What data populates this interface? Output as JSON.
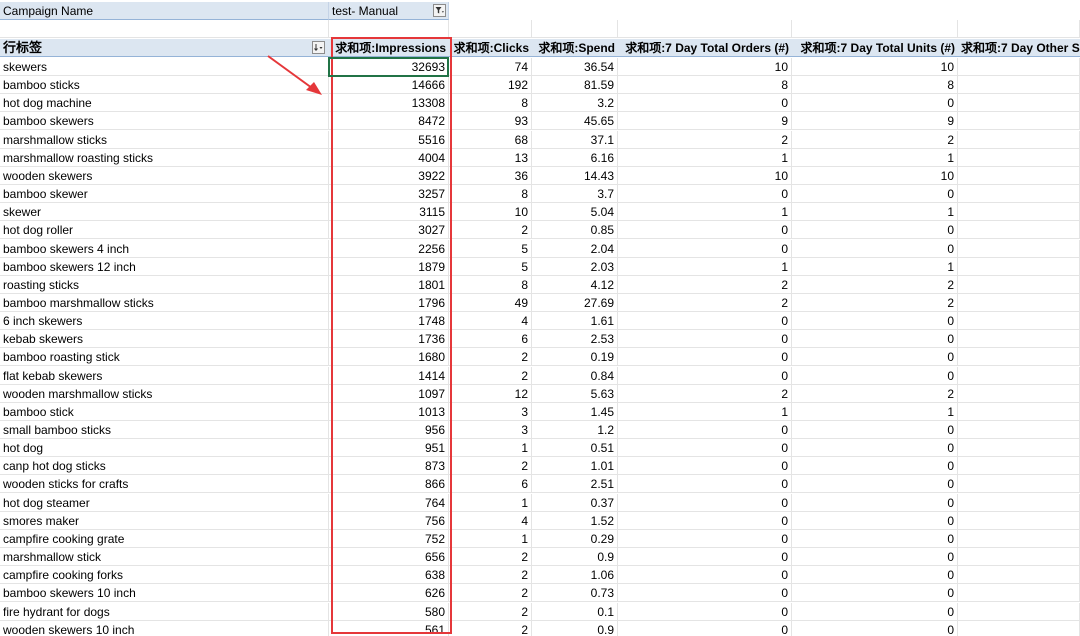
{
  "filter": {
    "label": "Campaign Name",
    "value": "test- Manual"
  },
  "columns": [
    "行标签",
    "求和项:Impressions",
    "求和项:Clicks",
    "求和项:Spend",
    "求和项:7 Day Total Orders (#)",
    "求和项:7 Day Total Units (#)",
    "求和项:7 Day Other S"
  ],
  "rows": [
    [
      "skewers",
      "32693",
      "74",
      "36.54",
      "10",
      "10"
    ],
    [
      "bamboo sticks",
      "14666",
      "192",
      "81.59",
      "8",
      "8"
    ],
    [
      "hot dog machine",
      "13308",
      "8",
      "3.2",
      "0",
      "0"
    ],
    [
      "bamboo skewers",
      "8472",
      "93",
      "45.65",
      "9",
      "9"
    ],
    [
      "marshmallow sticks",
      "5516",
      "68",
      "37.1",
      "2",
      "2"
    ],
    [
      "marshmallow roasting sticks",
      "4004",
      "13",
      "6.16",
      "1",
      "1"
    ],
    [
      "wooden skewers",
      "3922",
      "36",
      "14.43",
      "10",
      "10"
    ],
    [
      "bamboo skewer",
      "3257",
      "8",
      "3.7",
      "0",
      "0"
    ],
    [
      "skewer",
      "3115",
      "10",
      "5.04",
      "1",
      "1"
    ],
    [
      "hot dog roller",
      "3027",
      "2",
      "0.85",
      "0",
      "0"
    ],
    [
      "bamboo skewers 4 inch",
      "2256",
      "5",
      "2.04",
      "0",
      "0"
    ],
    [
      "bamboo skewers 12 inch",
      "1879",
      "5",
      "2.03",
      "1",
      "1"
    ],
    [
      "roasting sticks",
      "1801",
      "8",
      "4.12",
      "2",
      "2"
    ],
    [
      "bamboo marshmallow sticks",
      "1796",
      "49",
      "27.69",
      "2",
      "2"
    ],
    [
      "6 inch skewers",
      "1748",
      "4",
      "1.61",
      "0",
      "0"
    ],
    [
      "kebab skewers",
      "1736",
      "6",
      "2.53",
      "0",
      "0"
    ],
    [
      "bamboo roasting stick",
      "1680",
      "2",
      "0.19",
      "0",
      "0"
    ],
    [
      "flat kebab skewers",
      "1414",
      "2",
      "0.84",
      "0",
      "0"
    ],
    [
      "wooden marshmallow sticks",
      "1097",
      "12",
      "5.63",
      "2",
      "2"
    ],
    [
      "bamboo stick",
      "1013",
      "3",
      "1.45",
      "1",
      "1"
    ],
    [
      "small bamboo sticks",
      "956",
      "3",
      "1.2",
      "0",
      "0"
    ],
    [
      "hot dog",
      "951",
      "1",
      "0.51",
      "0",
      "0"
    ],
    [
      "canp hot dog sticks",
      "873",
      "2",
      "1.01",
      "0",
      "0"
    ],
    [
      "wooden sticks for crafts",
      "866",
      "6",
      "2.51",
      "0",
      "0"
    ],
    [
      "hot dog steamer",
      "764",
      "1",
      "0.37",
      "0",
      "0"
    ],
    [
      "smores maker",
      "756",
      "4",
      "1.52",
      "0",
      "0"
    ],
    [
      "campfire cooking grate",
      "752",
      "1",
      "0.29",
      "0",
      "0"
    ],
    [
      "marshmallow stick",
      "656",
      "2",
      "0.9",
      "0",
      "0"
    ],
    [
      "campfire cooking forks",
      "638",
      "2",
      "1.06",
      "0",
      "0"
    ],
    [
      "bamboo skewers 10 inch",
      "626",
      "2",
      "0.73",
      "0",
      "0"
    ],
    [
      "fire hydrant for dogs",
      "580",
      "2",
      "0.1",
      "0",
      "0"
    ],
    [
      "wooden skewers 10 inch",
      "561",
      "2",
      "0.9",
      "0",
      "0"
    ]
  ],
  "icons": {
    "filter": "filter-icon",
    "row_label_dropdown": "sort-dropdown-icon"
  },
  "colors": {
    "header_bg": "#dce6f1",
    "highlight_box": "#e5373a",
    "selection": "#217346"
  }
}
